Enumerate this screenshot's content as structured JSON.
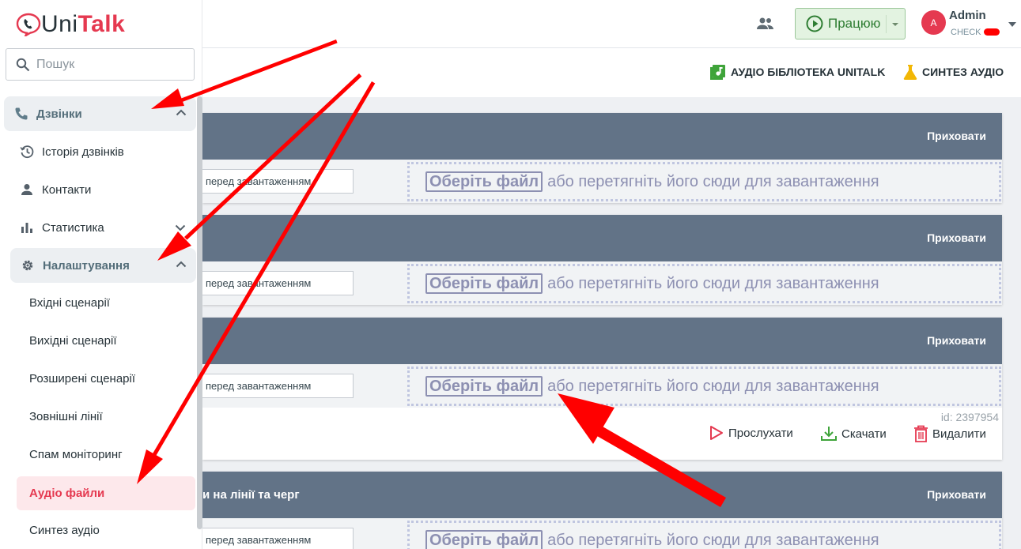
{
  "logo": {
    "uni": "Uni",
    "talk": "Talk"
  },
  "search": {
    "placeholder": "Пошук"
  },
  "header": {
    "status_label": "Працюю",
    "user_initial": "A",
    "user_name": "Admin",
    "user_sub": "CHECK"
  },
  "toolbar": {
    "audio_library": "АУДІО БІБЛІОТЕКА UNITALK",
    "synth_audio": "СИНТЕЗ АУДІО"
  },
  "sidebar": {
    "calls_group": "Дзвінки",
    "call_history": "Історія дзвінків",
    "contacts": "Контакти",
    "statistics": "Статистика",
    "settings_group": "Налаштування",
    "sub_items": [
      "Вхідні сценарії",
      "Вихідні сценарії",
      "Розширені сценарії",
      "Зовнішні лінії",
      "Спам моніторинг"
    ],
    "active_item": "Аудіо файли",
    "synth_item": "Синтез аудіо"
  },
  "cards": [
    {
      "title": "",
      "hide": "Приховати",
      "name_placeholder": "перед завантаженням"
    },
    {
      "title": "",
      "hide": "Приховати",
      "name_placeholder": "перед завантаженням"
    },
    {
      "title": "",
      "hide": "Приховати",
      "name_placeholder": "перед завантаженням",
      "id": "id: 2397954",
      "listen": "Прослухати",
      "download": "Скачати",
      "delete": "Видалити"
    },
    {
      "title": "и на лінії та черг",
      "hide": "Приховати",
      "name_placeholder": "перед завантаженням"
    }
  ],
  "dropzone": {
    "choose": "Оберіть файл",
    "text": "або перетягніть його сюди для завантаження"
  },
  "colors": {
    "brand": "#e53950",
    "header_band": "#627387",
    "accent_green": "#2e7d32",
    "annotation": "#ff0000"
  }
}
